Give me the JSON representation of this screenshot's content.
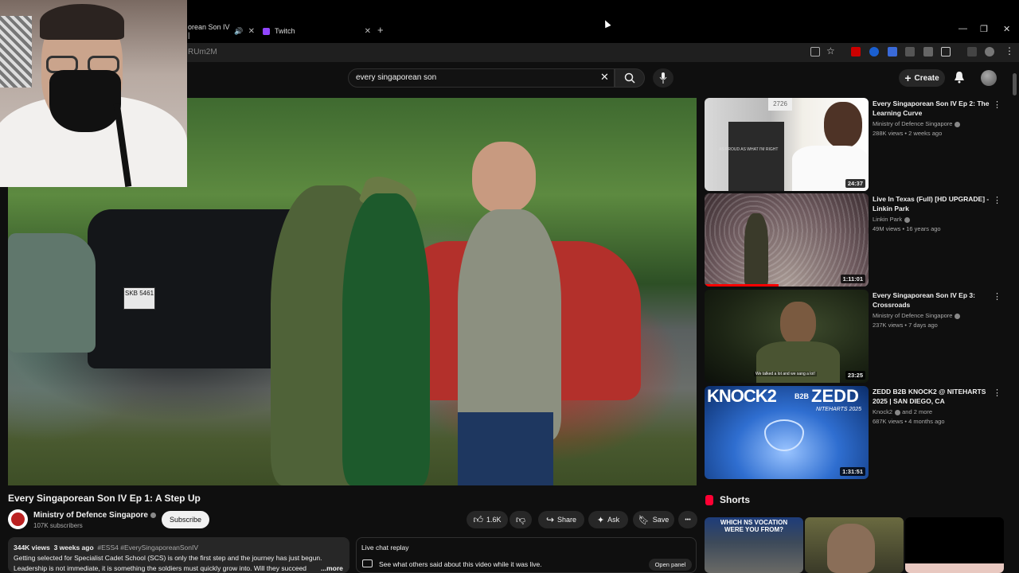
{
  "browser": {
    "tabs": [
      {
        "label": "orean Son IV |",
        "close": "✕"
      },
      {
        "label": "Twitch",
        "close": "✕"
      }
    ],
    "new_tab": "+",
    "url": "RUm2M",
    "window_controls": [
      "—",
      "❐",
      "✕"
    ]
  },
  "header": {
    "search_value": "every singaporean son",
    "search_clear": "✕",
    "create_label": "Create",
    "create_plus": "+"
  },
  "video": {
    "title": "Every Singaporean Son IV Ep 1: A Step Up",
    "channel": "Ministry of Defence Singapore",
    "subscribers": "107K subscribers",
    "subscribe_label": "Subscribe",
    "likes": "1.6K",
    "share_label": "Share",
    "ask_label": "Ask",
    "save_label": "Save",
    "more_label": "•••",
    "plate": "SKB 5461"
  },
  "description": {
    "views": "344K views",
    "age": "3 weeks ago",
    "hashtags": "#ESS4 #EverySingaporeanSonIV",
    "line1": "Getting selected for Specialist Cadet School (SCS) is only the first step and the journey has just begun.",
    "line2": "Leadership is not immediate, it is something the soldiers must quickly grow into. Will they succeed",
    "more": "...more"
  },
  "chat": {
    "title": "Live chat replay",
    "description": "See what others said about this video while it was live.",
    "open_label": "Open panel"
  },
  "recommendations": [
    {
      "title": "Every Singaporean Son IV Ep 2: The Learning Curve",
      "channel": "Ministry of Defence Singapore",
      "meta": "288K views • 2 weeks ago",
      "duration": "24:37",
      "verified": true
    },
    {
      "title": "Live In Texas (Full) [HD UPGRADE] - Linkin Park",
      "channel": "Linkin Park",
      "meta": "49M views • 16 years ago",
      "duration": "1:11:01",
      "verified": true,
      "progress": 0.45
    },
    {
      "title": "Every Singaporean Son IV Ep 3: Crossroads",
      "channel": "Ministry of Defence Singapore",
      "meta": "237K views • 7 days ago",
      "duration": "23:25",
      "verified": true
    },
    {
      "title": "ZEDD B2B KNOCK2 @ NITEHARTS 2025 | SAN DIEGO, CA",
      "channel": "Knock2",
      "channel_extra": "and 2 more",
      "meta": "687K views • 4 months ago",
      "duration": "1:31:51",
      "verified": true
    }
  ],
  "rec_thumb_text": {
    "r1_caption": "AS PROUD AS WHAT I'M RIGHT",
    "r1_tag": "2726",
    "r3_caption": "We talked a lot and we sang a lot!",
    "r4_big": "KNOCK2",
    "r4_b2b": "B2B",
    "r4_zedd": "ZEDD",
    "r4_sub": "NITEHARTS 2025"
  },
  "shorts": {
    "heading": "Shorts",
    "first_caption": "WHICH NS VOCATION WERE YOU FROM?"
  },
  "colors": {
    "accent_red": "#ff0000",
    "background": "#0f0f0f",
    "pill": "#272727"
  }
}
